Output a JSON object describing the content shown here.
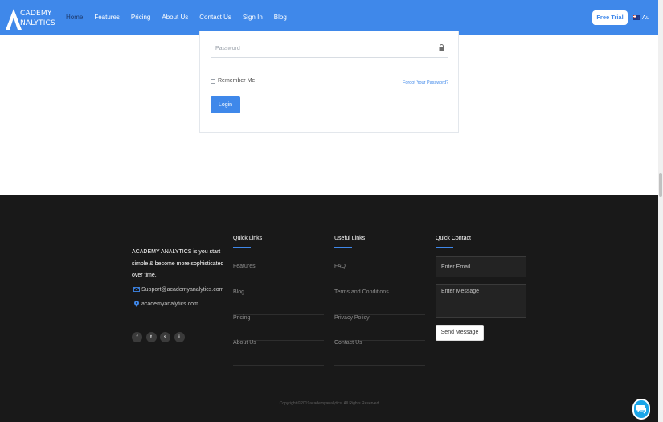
{
  "brand": {
    "logo_line1": "CADEMY",
    "logo_line2": "NALYTICS",
    "accent": "#3f88ea"
  },
  "nav": {
    "items": [
      "Home",
      "Features",
      "Pricing",
      "About Us",
      "Contact Us",
      "Sign In",
      "Blog"
    ],
    "active_index": 0,
    "trial_label": "Free Trial",
    "lang_label": "Au"
  },
  "login": {
    "password_placeholder": "Password",
    "remember_label": "Remember Me",
    "forgot_label": "Forgot Your Password?",
    "login_label": "Login"
  },
  "footer": {
    "about_text": "ACADEMY ANALYTICS is you start simple & become more sophisticated over time.",
    "support_email": "Support@academyanalytics.com",
    "location": "academyanalytics.com",
    "socials": [
      "f",
      "t",
      "s",
      "i"
    ],
    "quick_links": {
      "title": "Quick Links",
      "items": [
        "Features",
        "Blog",
        "Pricing",
        "About Us"
      ]
    },
    "useful_links": {
      "title": "Useful Links",
      "items": [
        "FAQ",
        "Terms and Conditions",
        "Privacy Policy",
        "Contact Us"
      ]
    },
    "quick_contact": {
      "title": "Quick Contact",
      "email_placeholder": "Enter Email",
      "message_placeholder": "Enter Message",
      "send_label": "Send Message"
    },
    "copyright": "Copyright ©2019academyanalytics. All Rights Reserved"
  }
}
